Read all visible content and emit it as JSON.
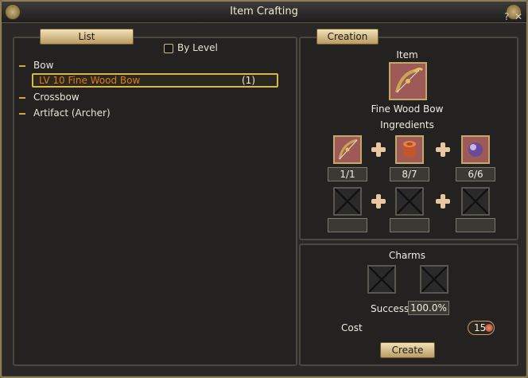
{
  "window": {
    "title": "Item Crafting",
    "help_label": "?",
    "close_label": "✕"
  },
  "left": {
    "tab_label": "List",
    "by_level_label": "By Level",
    "tree": [
      {
        "label": "Bow"
      },
      {
        "label": "Crossbow"
      },
      {
        "label": "Artifact (Archer)"
      }
    ],
    "selected": {
      "label": "LV 10 Fine Wood Bow",
      "count": "(1)"
    }
  },
  "right": {
    "tab_label": "Creation",
    "item_heading": "Item",
    "item_name": "Fine Wood Bow",
    "ingredients_heading": "Ingredients",
    "ingredients": [
      {
        "icon": "bow-icon",
        "count": "1/1"
      },
      {
        "icon": "wood-log-icon",
        "count": "8/7"
      },
      {
        "icon": "purple-orb-icon",
        "count": "6/6"
      }
    ],
    "charms_heading": "Charms",
    "success_label": "Success",
    "success_value": "100.0%",
    "cost_label": "Cost",
    "cost_value": "15",
    "create_label": "Create"
  },
  "colors": {
    "accent_gold": "#d8b84a",
    "selected_text": "#e07a1a",
    "button_face": "#e8d6a6"
  }
}
